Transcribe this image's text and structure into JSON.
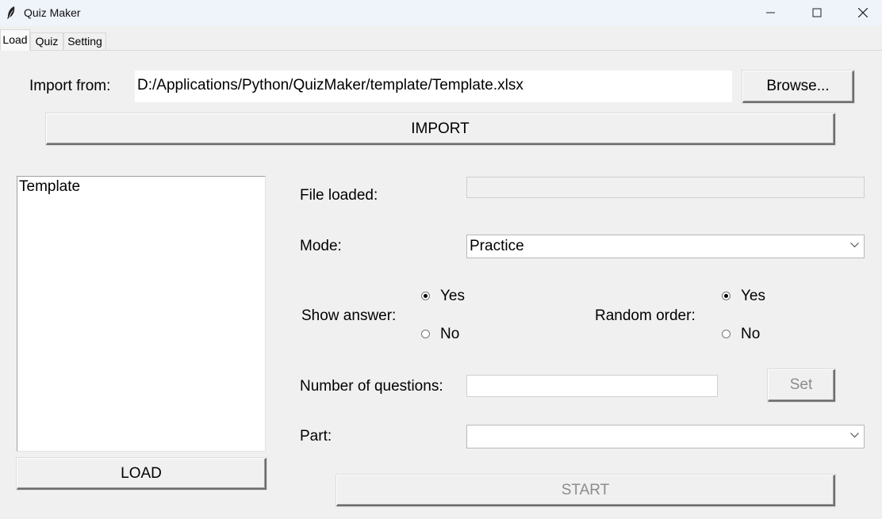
{
  "window": {
    "title": "Quiz Maker",
    "controls": {
      "minimize": "minimize-icon",
      "maximize": "maximize-icon",
      "close": "close-icon"
    }
  },
  "tabs": [
    {
      "label": "Load",
      "active": true
    },
    {
      "label": "Quiz",
      "active": false
    },
    {
      "label": "Setting",
      "active": false
    }
  ],
  "import": {
    "label": "Import from:",
    "path": "D:/Applications/Python/QuizMaker/template/Template.xlsx",
    "browse_label": "Browse...",
    "import_label": "IMPORT"
  },
  "list": {
    "items": [
      "Template"
    ],
    "load_label": "LOAD"
  },
  "form": {
    "file_loaded_label": "File loaded:",
    "file_loaded_value": "",
    "mode_label": "Mode:",
    "mode_value": "Practice",
    "show_answer_label": "Show answer:",
    "show_answer_yes": "Yes",
    "show_answer_no": "No",
    "show_answer_selected": "Yes",
    "random_order_label": "Random order:",
    "random_order_yes": "Yes",
    "random_order_no": "No",
    "random_order_selected": "Yes",
    "num_questions_label": "Number of questions:",
    "num_questions_value": "",
    "set_label": "Set",
    "part_label": "Part:",
    "part_value": "",
    "start_label": "START"
  }
}
